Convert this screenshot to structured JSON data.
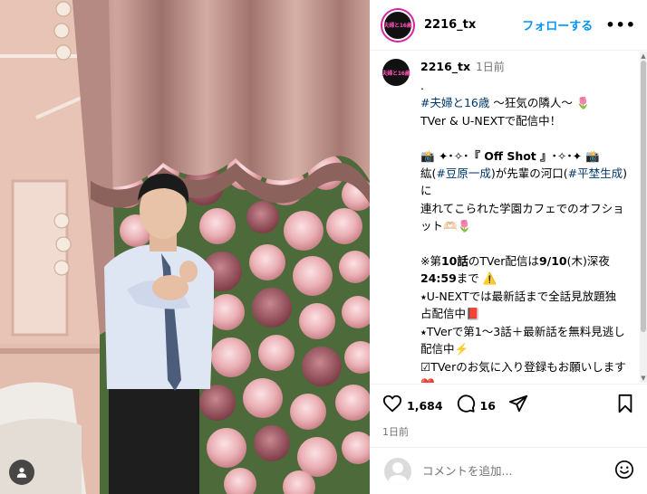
{
  "header": {
    "avatar_logo_text": "夫婦と16歳",
    "username": "2216_tx",
    "follow_label": "フォローする",
    "more_label": "•••"
  },
  "caption": {
    "username": "2216_tx",
    "time": "1日前",
    "line_dot": ".",
    "hashtag_title": "#夫婦と16歳",
    "title_rest": " 〜狂気の隣人〜 🌷",
    "distribution": "TVer & U-NEXTで配信中！",
    "offshot_heading": "📸 ✦･✧･『 Off Shot 』･✧･✦ 📸",
    "name1_prefix": "紘(",
    "name1_tag": "#豆原一成",
    "name1_suffix": ")が先輩の河口(",
    "name2_tag": "#平埜生成",
    "name2_suffix": ")に",
    "offshot_body": "連れてこられた学園カフェでのオフショット🫶🏻🌷",
    "notice_pre": "※第",
    "notice_ep": "10話",
    "notice_mid": "のTVer配信は",
    "notice_date": "9/10",
    "notice_day": "(木)深夜",
    "notice_time": "24:59",
    "notice_post": "まで ⚠️",
    "unext_line": "⭑U-NEXTでは最新話まで全話見放題独占配信中📕",
    "tver_line": "⭑TVerで第1〜3話＋最新話を無料見逃し配信中⚡️",
    "favorite_line": "☑TVerのお気に入り登録もお願いします❤️"
  },
  "actions": {
    "like_count": "1,684",
    "comment_count": "16",
    "time_ago": "1日前"
  },
  "comment_box": {
    "placeholder": "コメントを追加..."
  },
  "icons": {
    "like": "heart-icon",
    "comment": "comment-bubble-icon",
    "share": "paper-plane-icon",
    "save": "bookmark-icon",
    "emoji": "smiley-icon",
    "tag": "user-tag-icon"
  },
  "colors": {
    "accent_blue": "#0095f6",
    "hashtag": "#00376b",
    "muted": "#737373",
    "logo_pink": "#ff4fb8"
  }
}
